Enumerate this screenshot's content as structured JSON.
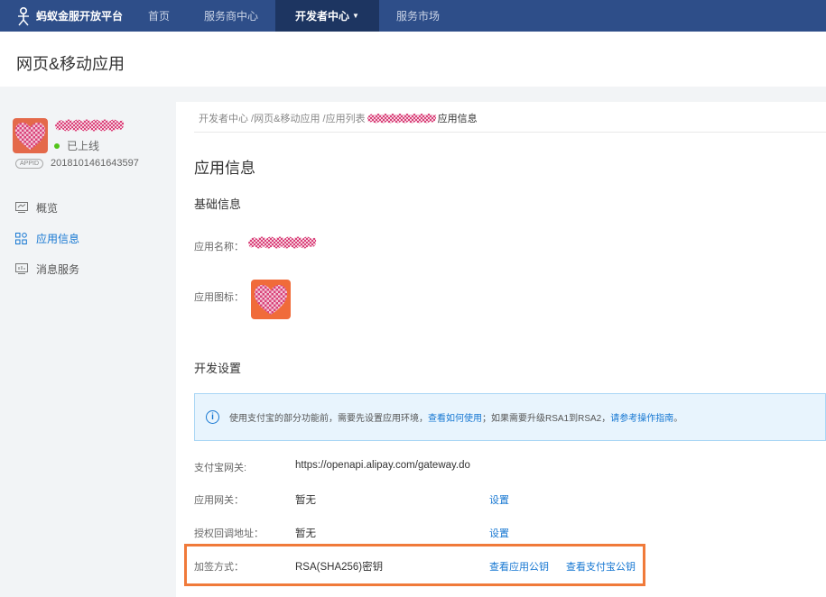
{
  "topnav": {
    "brand": "蚂蚁金服开放平台",
    "items": [
      {
        "label": "首页"
      },
      {
        "label": "服务商中心"
      },
      {
        "label": "开发者中心"
      },
      {
        "label": "服务市场"
      }
    ]
  },
  "header": {
    "title": "网页&移动应用"
  },
  "sidebar": {
    "status": "已上线",
    "appid_tag": "APPID",
    "appid": "2018101461643597",
    "items": [
      {
        "label": "概览",
        "icon": "monitor-icon"
      },
      {
        "label": "应用信息",
        "icon": "grid-icon",
        "active": true
      },
      {
        "label": "消息服务",
        "icon": "chart-icon"
      }
    ]
  },
  "breadcrumb": {
    "items": [
      "开发者中心 / ",
      "网页&移动应用 / ",
      "应用列表"
    ],
    "current": "应用信息"
  },
  "main": {
    "title": "应用信息",
    "basic_section": "基础信息",
    "app_name_label": "应用名称：",
    "app_icon_label": "应用图标：",
    "dev_section": "开发设置",
    "alert": {
      "text1": "使用支付宝的部分功能前，需要先设置应用环境，",
      "link1": "查看如何使用",
      "text2": "；如果需要升级RSA1到RSA2，",
      "link2": "请参考操作指南",
      "text3": "。"
    },
    "rows": [
      {
        "label": "支付宝网关:",
        "value": "https://openapi.alipay.com/gateway.do"
      },
      {
        "label": "应用网关：",
        "value": "暂无",
        "action": "设置"
      },
      {
        "label": "授权回调地址：",
        "value": "暂无",
        "action": "设置"
      },
      {
        "label": "加签方式：",
        "value": "RSA(SHA256)密钥",
        "action": "查看应用公钥",
        "action2": "查看支付宝公钥"
      }
    ]
  },
  "colors": {
    "nav_bg": "#2e4e89",
    "nav_active": "#1d3561",
    "link": "#1677d2",
    "highlight": "#f07a3a",
    "online": "#52c41a"
  }
}
